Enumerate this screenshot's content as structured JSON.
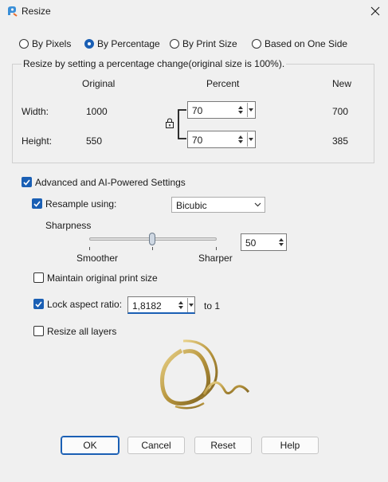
{
  "window": {
    "title": "Resize",
    "app_icon": "paint-palette-icon",
    "close_icon": "close-icon"
  },
  "mode_options": [
    {
      "label": "By Pixels",
      "selected": false
    },
    {
      "label": "By Percentage",
      "selected": true
    },
    {
      "label": "By Print Size",
      "selected": false
    },
    {
      "label": "Based on One Side",
      "selected": false
    }
  ],
  "group": {
    "title": "Resize by setting a percentage change(original size is 100%).",
    "col_original": "Original",
    "col_percent": "Percent",
    "col_new": "New",
    "width": {
      "label": "Width:",
      "original": "1000",
      "percent": "70",
      "new": "700"
    },
    "height": {
      "label": "Height:",
      "original": "550",
      "percent": "70",
      "new": "385"
    },
    "link_icon": "lock-icon"
  },
  "advanced": {
    "label": "Advanced and AI-Powered Settings",
    "checked": true,
    "resample": {
      "label": "Resample using:",
      "checked": true,
      "value": "Bicubic"
    },
    "sharpness": {
      "label": "Sharpness",
      "min_label": "Smoother",
      "max_label": "Sharper",
      "value": "50",
      "level": 0.5
    },
    "maintain_print_size": {
      "label": "Maintain original print size",
      "checked": false
    },
    "lock_aspect": {
      "label": "Lock aspect ratio:",
      "checked": true,
      "value": "1,8182",
      "suffix": "to 1"
    },
    "resize_all_layers": {
      "label": "Resize all layers",
      "checked": false
    }
  },
  "buttons": {
    "ok": "OK",
    "cancel": "Cancel",
    "reset": "Reset",
    "help": "Help"
  },
  "colors": {
    "accent": "#1a5fb4",
    "logo_gold": "#b8963e"
  }
}
